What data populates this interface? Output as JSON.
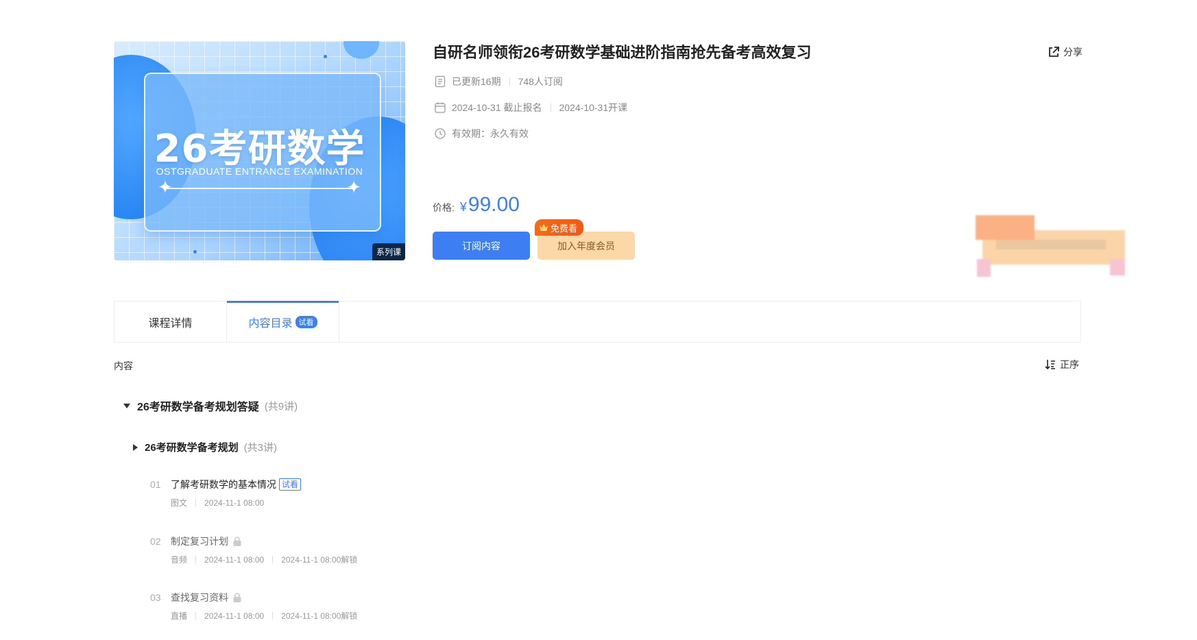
{
  "cover": {
    "main_text": "26考研数学",
    "sub_text": "OSTGRADUATE ENTRANCE EXAMINATION",
    "series_label": "系列课"
  },
  "course": {
    "title": "自研名师领衔26考研数学基础进阶指南抢先备考高效复习",
    "share_label": "分享",
    "updated": "已更新16期",
    "subscribers": "748人订阅",
    "signup_deadline": "2024-10-31 截止报名",
    "start_date": "2024-10-31开课",
    "validity": "有效期：永久有效",
    "price_label": "价格:",
    "price_currency": "¥",
    "price_amount": "99.00"
  },
  "actions": {
    "subscribe_label": "订阅内容",
    "vip_label": "加入年度会员",
    "free_badge": "免费看"
  },
  "tabs": [
    {
      "label": "课程详情",
      "badge": ""
    },
    {
      "label": "内容目录",
      "badge": "试看"
    }
  ],
  "catalog": {
    "content_label": "内容",
    "sort_label": "正序",
    "section": {
      "name": "26考研数学备考规划答疑",
      "count": "(共9讲)"
    },
    "subsection": {
      "name": "26考研数学备考规划",
      "count": "(共3讲)"
    },
    "lessons": [
      {
        "num": "01",
        "title": "了解考研数学的基本情况",
        "trial": "试看",
        "type": "图文",
        "time": "2024-11-1 08:00",
        "unlock": ""
      },
      {
        "num": "02",
        "title": "制定复习计划",
        "trial": "",
        "type": "音频",
        "time": "2024-11-1 08:00",
        "unlock": "2024-11-1 08:00解锁"
      },
      {
        "num": "03",
        "title": "查找复习资料",
        "trial": "",
        "type": "直播",
        "time": "2024-11-1 08:00",
        "unlock": "2024-11-1 08:00解锁"
      }
    ]
  },
  "colors": {
    "accent": "#3d7ef2",
    "vip": "#fcd8a8",
    "badge_orange": "#ef5a14"
  }
}
